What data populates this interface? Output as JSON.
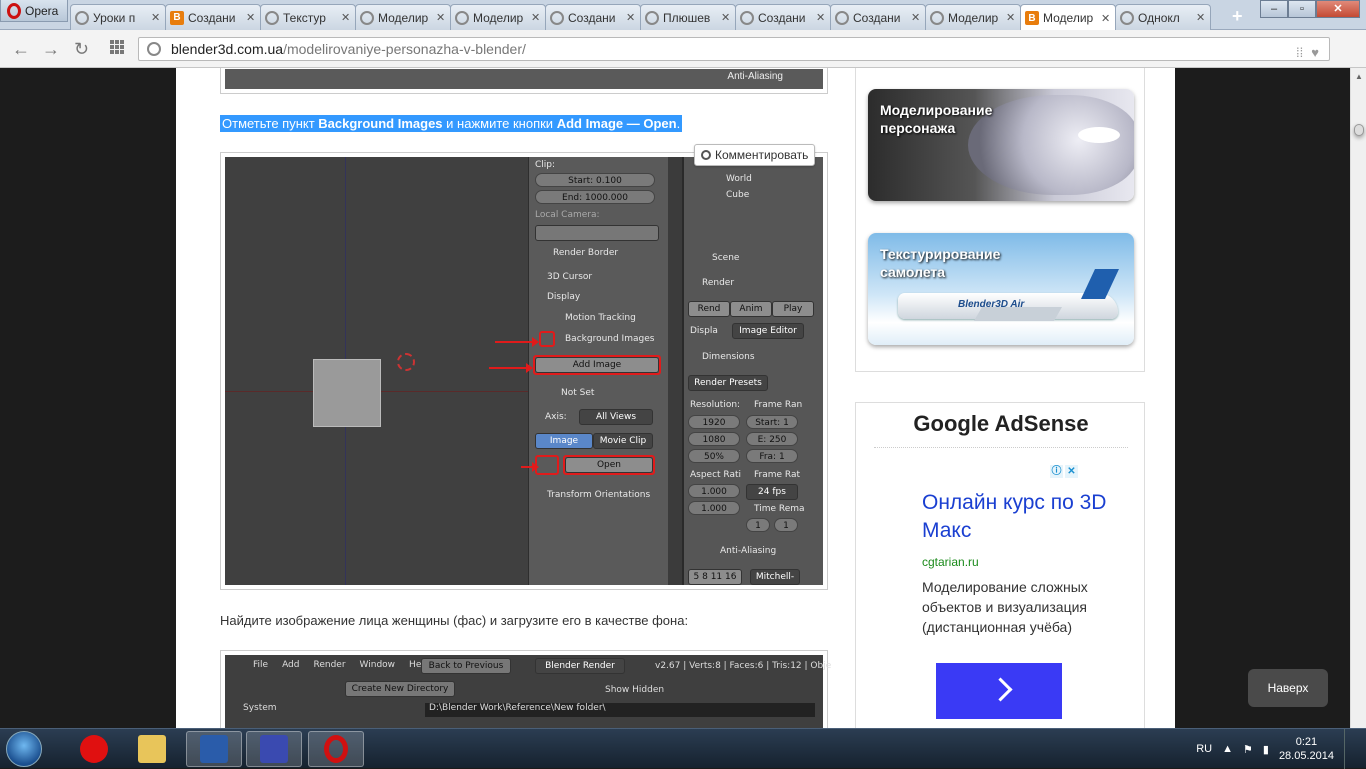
{
  "browser": {
    "menu_label": "Opera",
    "tabs": [
      {
        "title": "Уроки п",
        "icon": "globe-icon"
      },
      {
        "title": "Создани",
        "icon": "blender-b-icon"
      },
      {
        "title": "Текстур",
        "icon": "globe-icon"
      },
      {
        "title": "Моделир",
        "icon": "globe-icon"
      },
      {
        "title": "Моделир",
        "icon": "globe-icon"
      },
      {
        "title": "Создани",
        "icon": "globe-icon"
      },
      {
        "title": "Плюшев",
        "icon": "globe-icon"
      },
      {
        "title": "Создани",
        "icon": "globe-icon"
      },
      {
        "title": "Создани",
        "icon": "globe-icon"
      },
      {
        "title": "Моделир",
        "icon": "globe-icon"
      },
      {
        "title": "Моделир",
        "icon": "blender-b-icon",
        "active": true
      },
      {
        "title": "Однокл",
        "icon": "loading-icon"
      }
    ],
    "url_host": "blender3d.com.ua",
    "url_path": "/modelirovaniye-personazha-v-blender/"
  },
  "article": {
    "top_caption": "Anti-Aliasing",
    "highlight": {
      "prefix": "Отметьте пункт ",
      "bold1": "Background Images",
      "middle": " и нажмите кнопки ",
      "bold2": "Add Image — Open",
      "suffix": "."
    },
    "comment_button": "Комментировать",
    "paragraph2": "Найдите изображение лица женщины (фас) и загрузите его в качестве фона:"
  },
  "blender_props": {
    "clip": "Clip:",
    "start": "Start: 0.100",
    "end": "End: 1000.000",
    "local_camera": "Local Camera:",
    "render_border": "Render Border",
    "cursor3d": "3D Cursor",
    "display": "Display",
    "motion_tracking": "Motion Tracking",
    "background_images": "Background Images",
    "add_image": "Add Image",
    "not_set": "Not Set",
    "axis": "Axis:",
    "all_views": "All Views",
    "image": "Image",
    "movie_clip": "Movie Clip",
    "open": "Open",
    "transform_orientations": "Transform Orientations"
  },
  "blender_side": {
    "world": "World",
    "cube": "Cube",
    "scene": "Scene",
    "render": "Render",
    "rend": "Rend",
    "anim": "Anim",
    "play": "Play",
    "displa": "Displa",
    "image_editor": "Image Editor",
    "dimensions": "Dimensions",
    "render_presets": "Render Presets",
    "resolution": "Resolution:",
    "frame_ran": "Frame Ran",
    "res_x": "1920",
    "res_y": "1080",
    "res_pct": "50%",
    "f_start": "Start: 1",
    "f_end": "E: 250",
    "f_step": "Fra: 1",
    "aspect_rati": "Aspect Rati",
    "frame_rat": "Frame Rat",
    "asp_x": "1.000",
    "asp_y": "1.000",
    "fps": "24 fps",
    "time_rema": "Time Rema",
    "tr1": "1",
    "tr2": "1",
    "anti_aliasing": "Anti-Aliasing",
    "aa_vals": "5  8  11 16",
    "aa_filter": "Mitchell-"
  },
  "blender_bottom": {
    "menus": [
      "File",
      "Add",
      "Render",
      "Window",
      "Help"
    ],
    "back": "Back to Previous",
    "engine": "Blender Render",
    "stats": "v2.67 | Verts:8 | Faces:6 | Tris:12 | Obje",
    "create_dir": "Create New Directory",
    "show_hidden": "Show Hidden",
    "system": "System",
    "path": "D:\\Blender Work\\Reference\\New folder\\"
  },
  "sidebar": {
    "thumb1": "Моделирование\nперсонажа",
    "thumb2": "Текстурирование\nсамолета",
    "thumb2_brand": "Blender3D Air",
    "ads_title": "Google AdSense",
    "ad_headline": "Онлайн курс по 3D Макс",
    "ad_url": "cgtarian.ru",
    "ad_desc": "Моделирование сложных объектов и визуализация (дистанционная учёба)"
  },
  "page": {
    "to_top": "Наверх"
  },
  "taskbar": {
    "lang": "RU",
    "time": "0:21",
    "date": "28.05.2014"
  }
}
